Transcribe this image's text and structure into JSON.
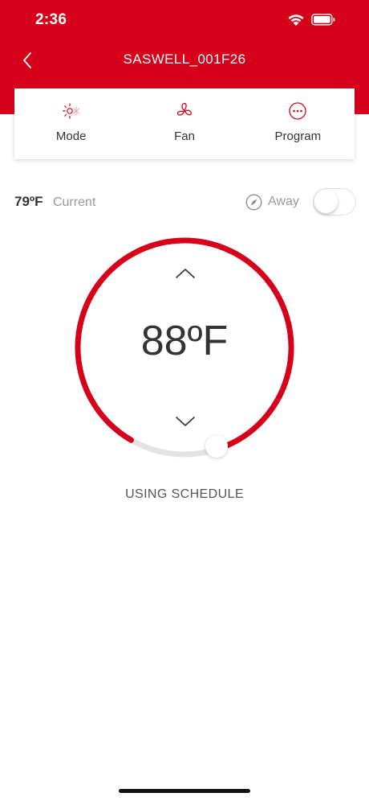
{
  "status_bar": {
    "time": "2:36"
  },
  "nav": {
    "title": "SASWELL_001F26"
  },
  "menu": [
    {
      "label": "Mode",
      "icon": "mode-sun-snow-icon"
    },
    {
      "label": "Fan",
      "icon": "fan-icon"
    },
    {
      "label": "Program",
      "icon": "more-dots-icon"
    }
  ],
  "current": {
    "temp": "79ºF",
    "label": "Current"
  },
  "away": {
    "label": "Away",
    "enabled": false
  },
  "setpoint": {
    "temp": "88ºF",
    "level": 0.85
  },
  "schedule_status": "USING SCHEDULE",
  "colors": {
    "accent": "#d7001a",
    "track": "#e3e3e3"
  }
}
